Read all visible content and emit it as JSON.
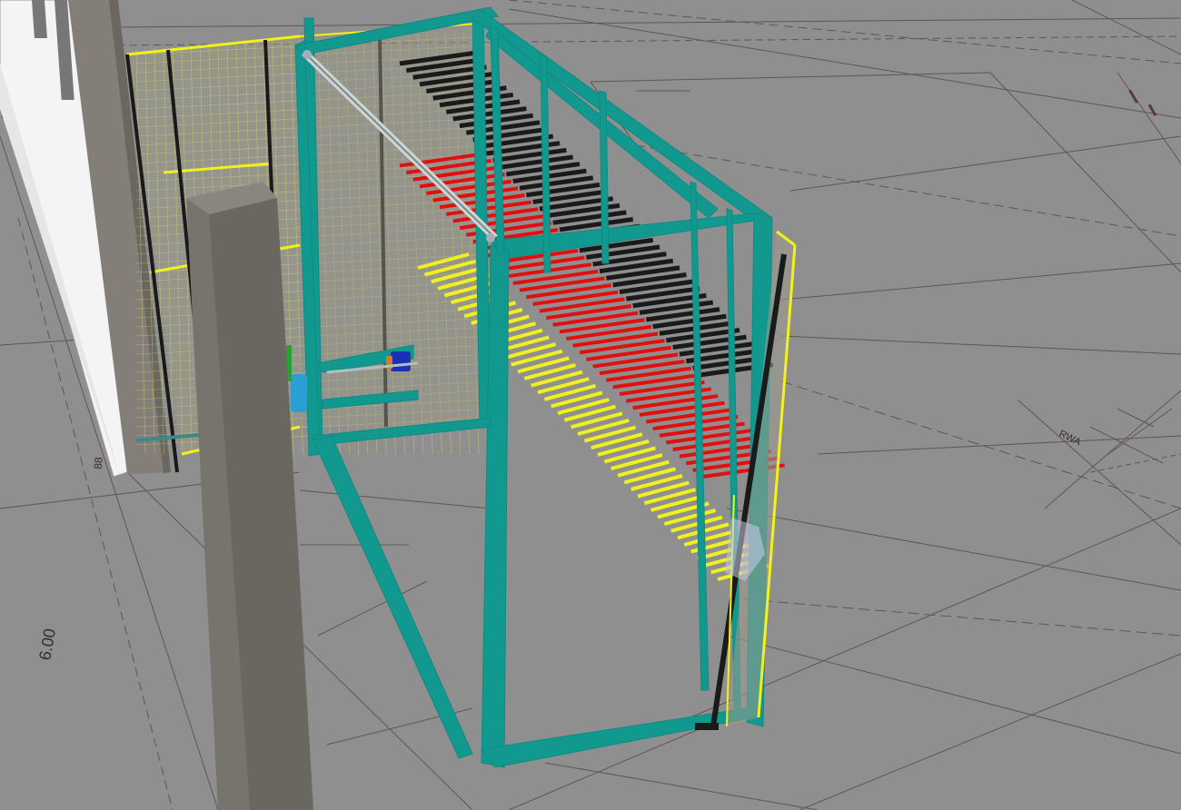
{
  "scene": {
    "background_color": "#8f8f8f",
    "floor_line_color": "#5a4a4a",
    "frame_color": "#12998f",
    "fence_color": "#f2f21a",
    "post_color": "#77746e",
    "wall_color": "#f2f2f2",
    "rod_colors": [
      "#1a1a1a",
      "#e01010",
      "#f0f020"
    ]
  },
  "annotations": {
    "dimension_600": "6.00",
    "dimension_88": "88",
    "label_rwa": "RWA"
  },
  "icons": [
    "motor-icon",
    "gear-motor-icon"
  ]
}
